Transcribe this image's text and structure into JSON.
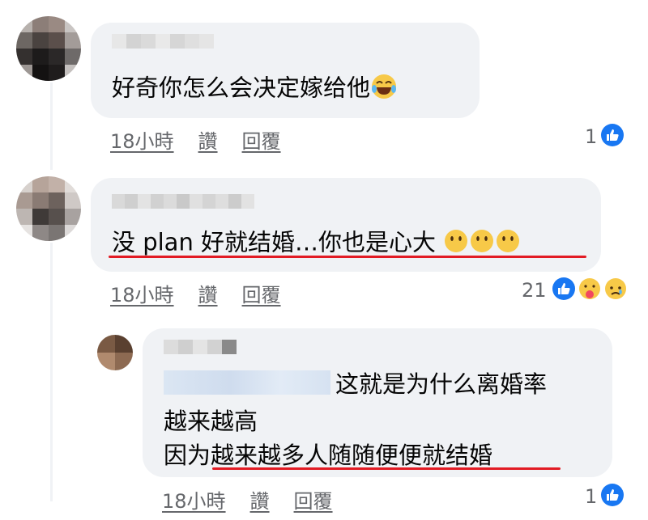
{
  "comments": [
    {
      "text": "好奇你怎么会决定嫁给他",
      "emoji": "laugh-cry-icon",
      "time": "18小時",
      "like_label": "讚",
      "reply_label": "回覆",
      "reaction_count": "1"
    },
    {
      "text": "没 plan 好就结婚…你也是心大",
      "emoji": "hushed-face-icon",
      "time": "18小時",
      "like_label": "讚",
      "reply_label": "回覆",
      "reaction_count": "21"
    }
  ],
  "reply": {
    "line1": "这就是为什么离婚率",
    "line2": "越来越高",
    "line3_prefix": "因为",
    "line3_underlined": "越来越多人随随便便就结婚",
    "time": "18小時",
    "like_label": "讚",
    "reply_label": "回覆",
    "reaction_count": "1"
  },
  "colors": {
    "bubble": "#f0f2f5",
    "meta_text": "#65676b",
    "like_blue": "#1877f2",
    "underline_red": "#e21b24"
  }
}
